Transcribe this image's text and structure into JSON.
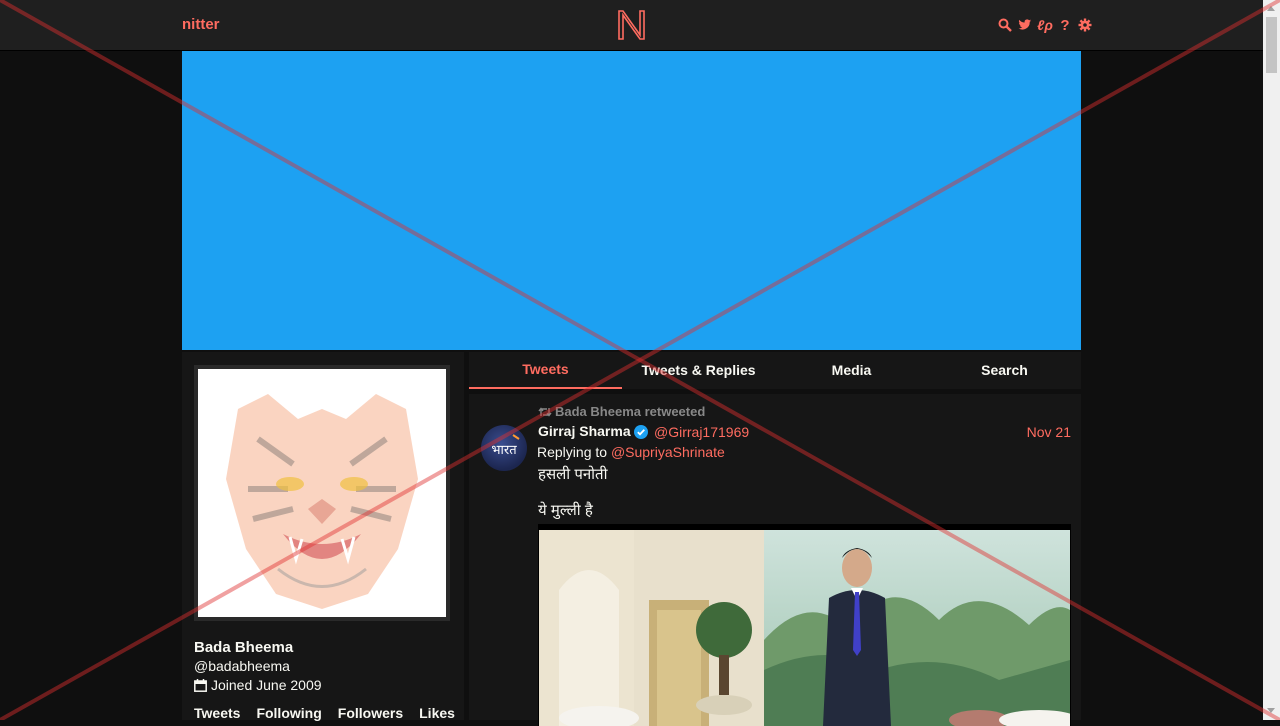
{
  "header": {
    "brand": "nitter",
    "logo_letter": "N",
    "icons": [
      "search-icon",
      "twitter-bird-icon",
      "rss-icon",
      "help-icon",
      "gear-icon"
    ]
  },
  "colors": {
    "accent": "#ff6c60",
    "banner": "#1da1f2",
    "background": "#0f0f0f",
    "panel": "#161616"
  },
  "profile": {
    "fullname": "Bada Bheema",
    "username": "@badabheema",
    "joined": "Joined June 2009",
    "stats": [
      "Tweets",
      "Following",
      "Followers",
      "Likes"
    ]
  },
  "tabs": [
    {
      "label": "Tweets",
      "active": true
    },
    {
      "label": "Tweets & Replies",
      "active": false
    },
    {
      "label": "Media",
      "active": false
    },
    {
      "label": "Search",
      "active": false
    }
  ],
  "tweet": {
    "retweet_label": "Bada Bheema retweeted",
    "author_name": "Girraj Sharma",
    "author_handle": "@Girraj171969",
    "date": "Nov 21",
    "replying_prefix": "Replying to",
    "replying_to": "@SupriyaShrinate",
    "text_line1": "हसली पनोती",
    "text_line2": "ये मुल्ली है"
  }
}
